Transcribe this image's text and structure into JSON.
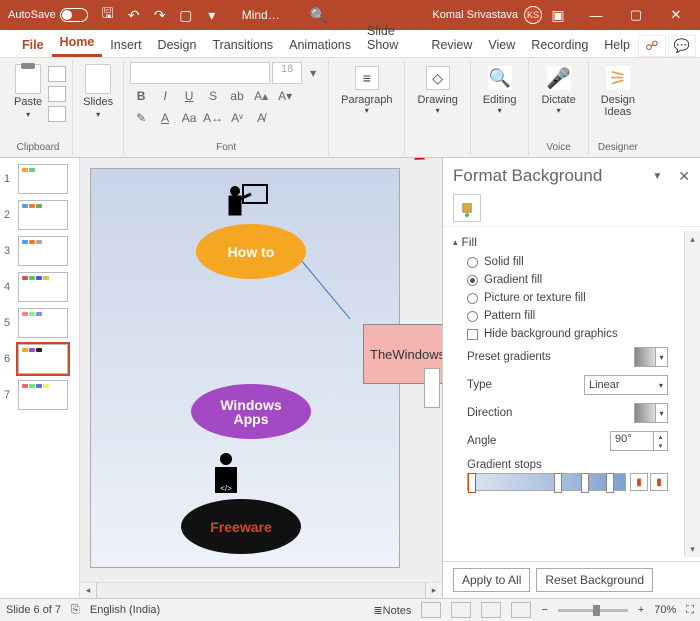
{
  "titlebar": {
    "autosave": "AutoSave",
    "doc": "Mind…",
    "user": "Komal Srivastava",
    "initials": "KS"
  },
  "tabs": {
    "file": "File",
    "home": "Home",
    "insert": "Insert",
    "design": "Design",
    "transitions": "Transitions",
    "animations": "Animations",
    "slideshow": "Slide Show",
    "review": "Review",
    "view": "View",
    "recording": "Recording",
    "help": "Help"
  },
  "ribbon": {
    "paste": "Paste",
    "clipboard": "Clipboard",
    "slides": "Slides",
    "font_size": "18",
    "font_label": "Font",
    "paragraph": "Paragraph",
    "drawing": "Drawing",
    "editing": "Editing",
    "dictate": "Dictate",
    "voice": "Voice",
    "design_ideas": "Design\nIdeas",
    "designer": "Designer"
  },
  "slide_content": {
    "howto": "How to",
    "windows_apps_l1": "Windows",
    "windows_apps_l2": "Apps",
    "freeware": "Freeware",
    "thewindows": "TheWindows"
  },
  "thumbs": [
    "1",
    "2",
    "3",
    "4",
    "5",
    "6",
    "7"
  ],
  "pane": {
    "title": "Format Background",
    "section_fill": "Fill",
    "solid": "Solid fill",
    "gradient": "Gradient fill",
    "picture": "Picture or texture fill",
    "pattern": "Pattern fill",
    "hide": "Hide background graphics",
    "preset": "Preset gradients",
    "type": "Type",
    "type_val": "Linear",
    "direction": "Direction",
    "angle": "Angle",
    "angle_val": "90°",
    "stops": "Gradient stops",
    "apply": "Apply to All",
    "reset": "Reset Background"
  },
  "status": {
    "slide": "Slide 6 of 7",
    "lang": "English (India)",
    "notes": "Notes",
    "zoom": "70%"
  }
}
